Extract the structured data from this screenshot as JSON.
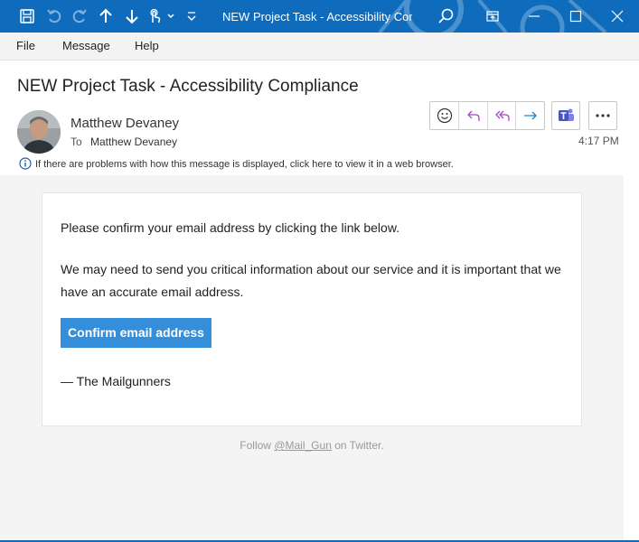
{
  "window": {
    "title": "NEW Project Task - Accessibility Com...",
    "accent_color": "#0f6cbd",
    "toolbar_icons": [
      "save-icon",
      "undo-icon",
      "redo-icon",
      "up-arrow-icon",
      "down-arrow-icon",
      "touch-mode-icon",
      "customize-toolbar-icon"
    ],
    "controls": [
      "search-icon",
      "restore-icon",
      "minimize-icon",
      "maximize-icon",
      "close-icon"
    ]
  },
  "menu": {
    "items": [
      "File",
      "Message",
      "Help"
    ]
  },
  "message": {
    "subject": "NEW Project Task - Accessibility Compliance",
    "sender": "Matthew Devaney",
    "to_label": "To",
    "to_value": "Matthew Devaney",
    "time": "4:17 PM",
    "info": "If there are problems with how this message is displayed, click here to view it in a web browser.",
    "actions": [
      "emoji-icon",
      "reply-icon",
      "reply-all-icon",
      "forward-icon",
      "teams-icon",
      "more-icon"
    ]
  },
  "email_body": {
    "line1": "Please confirm your email address by clicking the link below.",
    "line2": "We may need to send you critical information about our service and it is important that we have an accurate email address.",
    "button_label": "Confirm email address",
    "button_color": "#348eda",
    "signoff": "— The Mailgunners",
    "footer_prefix": "Follow",
    "footer_link": "@Mail_Gun",
    "footer_suffix": "on Twitter."
  }
}
